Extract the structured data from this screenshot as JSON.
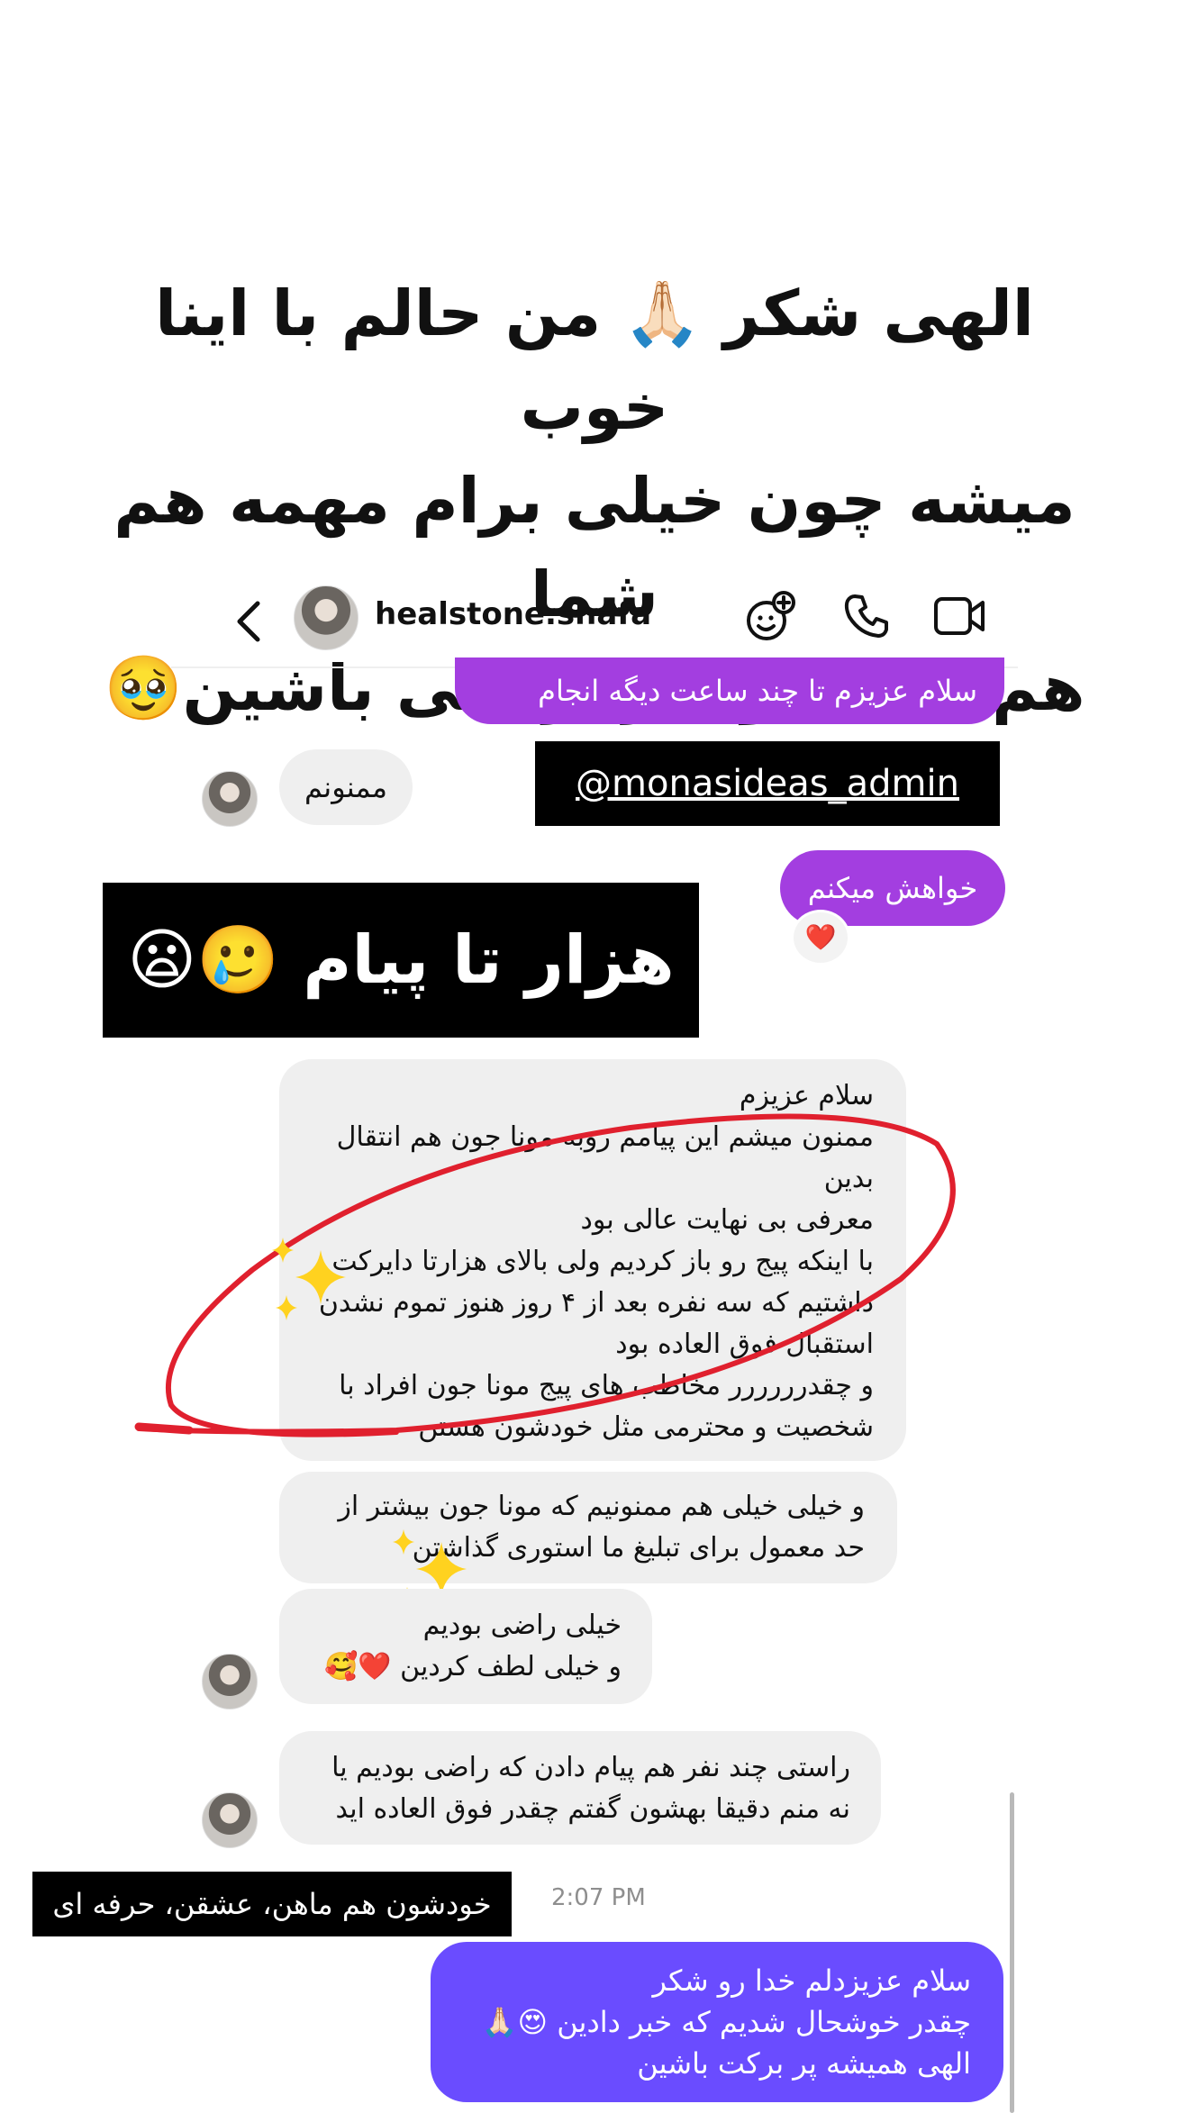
{
  "headline": {
    "line1": "الهی شکر 🙏🏻 من حالم با اینا خوب",
    "line2": "میشه چون خیلی برام مهمه هم شما",
    "line3": "هم کسب و کارا راضی باشین🥹"
  },
  "header": {
    "username": "healstone.shafa",
    "back_icon": "chevron-left-icon",
    "effects_icon": "effects-sparkle-icon",
    "phone_icon": "phone-icon",
    "video_icon": "video-camera-icon"
  },
  "messages": {
    "sent_1": "سلام عزیزم تا چند ساعت دیگه انجام میشه",
    "recv_1": "ممنونم",
    "sent_2": "خواهش میکنم",
    "sent_2_reaction": "❤️",
    "recv_long": {
      "line1": "سلام عزیزم",
      "line2": "ممنون میشم این پیامم روبه مونا جون هم انتقال",
      "line3": "بدین",
      "line4": "معرفی بی نهایت عالی بود",
      "line5": "با اینکه پیج رو باز کردیم ولی بالای هزارتا دایرکت",
      "line6": "داشتیم که سه نفره بعد از ۴ روز هنوز تموم نشدن",
      "line7": "استقبال فوق العاده بود",
      "line8": "و چقدرررررر مخاطب های پیج مونا جون افراد با",
      "line9": "شخصیت و محترمی مثل خودشون هستن"
    },
    "recv_thanks": {
      "line1": "و خیلی خیلی هم ممنونیم که مونا جون بیشتر از",
      "line2": "حد معمول برای تبلیغ ما استوری گذاشتن"
    },
    "recv_happy": {
      "line1": "خیلی راضی بودیم",
      "line2": "و خیلی لطف کردین ❤️🥰"
    },
    "recv_others": {
      "line1": "راستی چند نفر هم پیام دادن که راضی بودیم یا",
      "line2": "نه منم دقیقا بهشون گفتم چقدر فوق العاده اید"
    },
    "timestamp": "2:07 PM",
    "sent_final": {
      "line1": "سلام عزیزدلم خدا رو شکر",
      "line2": "چقدر خوشحال شدیم که خبر دادین 😍🙏🏻",
      "line3": "الهی همیشه پر برکت باشین"
    }
  },
  "overlays": {
    "admin_tag": "@monasideas_admin",
    "thousand_messages": "هزار تا پیام 🥲😦",
    "caption_bottom": "خودشون هم ماهن، عشقن، حرفه ای"
  },
  "colors": {
    "sent_purple": "#a33ee0",
    "sent_violet": "#6a4cff",
    "received": "#efefef",
    "annotation_red": "#e0202e"
  }
}
